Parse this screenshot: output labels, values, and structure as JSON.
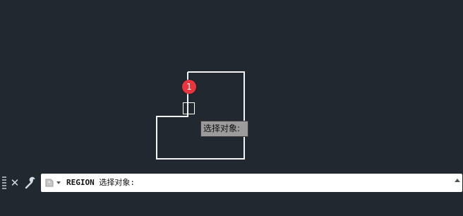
{
  "canvas": {
    "background": "#212830",
    "stroke_color": "#ffffff"
  },
  "marker": {
    "label": "1",
    "color": "#e8343c"
  },
  "tooltip": {
    "text": "选择对象:"
  },
  "command_line": {
    "close_icon": "close-icon",
    "settings_icon": "wrench-icon",
    "recent_icon": "recent-commands-icon",
    "command": "REGION",
    "prompt": " 选择对象:",
    "cursor": " "
  }
}
